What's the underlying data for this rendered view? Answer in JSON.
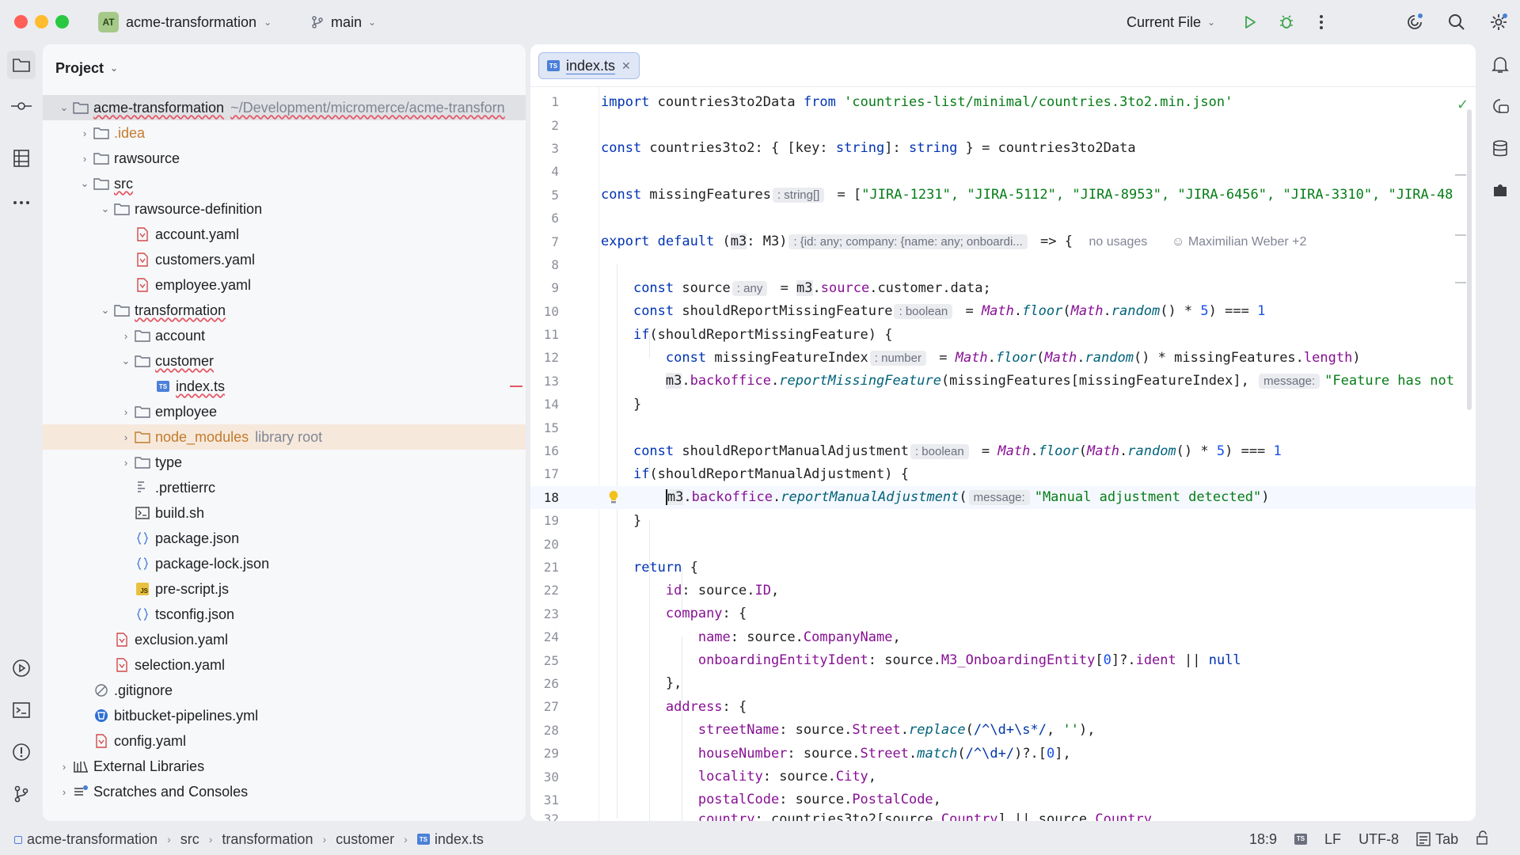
{
  "titlebar": {
    "project_badge": "AT",
    "project_name": "acme-transformation",
    "branch": "main",
    "run_config": "Current File"
  },
  "project_panel": {
    "title": "Project",
    "root_name": "acme-transformation",
    "root_path": "~/Development/micromerce/acme-transforn",
    "tree": [
      {
        "label": ".idea",
        "color": "#c47a2c"
      },
      {
        "label": "rawsource"
      },
      {
        "label": "src"
      },
      {
        "label": "rawsource-definition"
      },
      {
        "label": "account.yaml"
      },
      {
        "label": "customers.yaml"
      },
      {
        "label": "employee.yaml"
      },
      {
        "label": "transformation"
      },
      {
        "label": "account"
      },
      {
        "label": "customer"
      },
      {
        "label": "index.ts"
      },
      {
        "label": "employee"
      },
      {
        "label": "node_modules",
        "suffix": "library root"
      },
      {
        "label": "type"
      },
      {
        "label": ".prettierrc"
      },
      {
        "label": "build.sh"
      },
      {
        "label": "package.json"
      },
      {
        "label": "package-lock.json"
      },
      {
        "label": "pre-script.js"
      },
      {
        "label": "tsconfig.json"
      },
      {
        "label": "exclusion.yaml"
      },
      {
        "label": "selection.yaml"
      },
      {
        "label": ".gitignore"
      },
      {
        "label": "bitbucket-pipelines.yml"
      },
      {
        "label": "config.yaml"
      },
      {
        "label": "External Libraries"
      },
      {
        "label": "Scratches and Consoles"
      }
    ]
  },
  "editor": {
    "tab_label": "index.ts",
    "tab_badge": "TS",
    "line_numbers": [
      "1",
      "2",
      "3",
      "4",
      "5",
      "6",
      "7",
      "8",
      "9",
      "10",
      "11",
      "12",
      "13",
      "14",
      "15",
      "16",
      "17",
      "18",
      "19",
      "20",
      "21",
      "22",
      "23",
      "24",
      "25",
      "26",
      "27",
      "28",
      "29",
      "30",
      "31",
      "32"
    ],
    "hints": {
      "l5": ": string[]",
      "l7": ": {id: any; company: {name: any; onboardi...",
      "l7_usages": "no usages",
      "l7_author": "Maximilian Weber +2",
      "l9": ": any",
      "l10": ": boolean",
      "l12": ": number",
      "l13": "message:",
      "l16": ": boolean",
      "l18": "message:"
    },
    "code": {
      "l1_a": "import",
      "l1_b": " countries3to2Data ",
      "l1_c": "from",
      "l1_d": " ",
      "l1_e": "'countries-list/minimal/countries.3to2.min.json'",
      "l3_a": "const",
      "l3_b": " countries3to2: { [key: ",
      "l3_c": "string",
      "l3_d": "]: ",
      "l3_e": "string",
      "l3_f": " } = countries3to2Data",
      "l5_a": "const",
      "l5_b": " missingFeatures",
      "l5_c": " = [",
      "l5_d": "\"JIRA-1231\", \"JIRA-5112\", \"JIRA-8953\", \"JIRA-6456\", \"JIRA-3310\", \"JIRA-48",
      "l7_a": "export default",
      "l7_b": " (",
      "l7_c": "m3",
      "l7_d": ": M3)",
      "l7_e": " => {",
      "l9_a": "const",
      "l9_b": " source",
      "l9_c": " = ",
      "l9_d": "m3",
      "l9_e": ".",
      "l9_f": "source",
      "l9_g": ".customer.data;",
      "l10_a": "const",
      "l10_b": " shouldReportMissingFeature",
      "l10_c": " = ",
      "l10_d": "Math",
      "l10_e": ".",
      "l10_f": "floor",
      "l10_g": "(",
      "l10_h": "Math",
      "l10_i": ".",
      "l10_j": "random",
      "l10_k": "() * ",
      "l10_l": "5",
      "l10_m": ") === ",
      "l10_n": "1",
      "l11_a": "if",
      "l11_b": "(shouldReportMissingFeature) {",
      "l12_a": "const",
      "l12_b": " missingFeatureIndex",
      "l12_c": " = ",
      "l12_d": "Math",
      "l12_e": ".",
      "l12_f": "floor",
      "l12_g": "(",
      "l12_h": "Math",
      "l12_i": ".",
      "l12_j": "random",
      "l12_k": "() * missingFeatures.",
      "l12_l": "length",
      "l12_m": ")",
      "l13_a": "m3",
      "l13_b": ".",
      "l13_c": "backoffice",
      "l13_d": ".",
      "l13_e": "reportMissingFeature",
      "l13_f": "(missingFeatures[missingFeatureIndex],",
      "l13_g": "\"Feature has not",
      "l14_a": "}",
      "l16_a": "const",
      "l16_b": " shouldReportManualAdjustment",
      "l16_c": " = ",
      "l16_d": "Math",
      "l16_e": ".",
      "l16_f": "floor",
      "l16_g": "(",
      "l16_h": "Math",
      "l16_i": ".",
      "l16_j": "random",
      "l16_k": "() * ",
      "l16_l": "5",
      "l16_m": ") === ",
      "l16_n": "1",
      "l17_a": "if",
      "l17_b": "(shouldReportManualAdjustment) {",
      "l18_a": "m3",
      "l18_b": ".",
      "l18_c": "backoffice",
      "l18_d": ".",
      "l18_e": "reportManualAdjustment",
      "l18_f": "(",
      "l18_g": "\"Manual adjustment detected\"",
      "l18_h": ")",
      "l19_a": "}",
      "l21_a": "return",
      "l21_b": " {",
      "l22_a": "id",
      "l22_b": ": source.",
      "l22_c": "ID",
      "l22_d": ",",
      "l23_a": "company",
      "l23_b": ": {",
      "l24_a": "name",
      "l24_b": ": source.",
      "l24_c": "CompanyName",
      "l24_d": ",",
      "l25_a": "onboardingEntityIdent",
      "l25_b": ": source.",
      "l25_c": "M3_OnboardingEntity",
      "l25_d": "[",
      "l25_e": "0",
      "l25_f": "]?.",
      "l25_g": "ident",
      "l25_h": " || ",
      "l25_i": "null",
      "l26_a": "},",
      "l27_a": "address",
      "l27_b": ": {",
      "l28_a": "streetName",
      "l28_b": ": source.",
      "l28_c": "Street",
      "l28_d": ".",
      "l28_e": "replace",
      "l28_f": "(",
      "l28_g": "/^\\d+\\s*/",
      "l28_h": ", ",
      "l28_i": "''",
      "l28_j": "),",
      "l29_a": "houseNumber",
      "l29_b": ": source.",
      "l29_c": "Street",
      "l29_d": ".",
      "l29_e": "match",
      "l29_f": "(",
      "l29_g": "/^\\d+/",
      "l29_h": ")?.[",
      "l29_i": "0",
      "l29_j": "],",
      "l30_a": "locality",
      "l30_b": ": source.",
      "l30_c": "City",
      "l30_d": ",",
      "l31_a": "postalCode",
      "l31_b": ": source.",
      "l31_c": "PostalCode",
      "l31_d": ",",
      "l32_a": "country",
      "l32_b": ": countries3to2[source.",
      "l32_c": "Country",
      "l32_d": "] || source.",
      "l32_e": "Country"
    }
  },
  "statusbar": {
    "crumbs": [
      "acme-transformation",
      "src",
      "transformation",
      "customer",
      "index.ts"
    ],
    "position": "18:9",
    "line_ending": "LF",
    "encoding": "UTF-8",
    "indent": "Tab"
  },
  "colors": {
    "keyword": "#0033b3",
    "string": "#067d17",
    "number": "#1750eb",
    "function": "#00627a",
    "property": "#871094",
    "accent": "#4a80d8"
  }
}
